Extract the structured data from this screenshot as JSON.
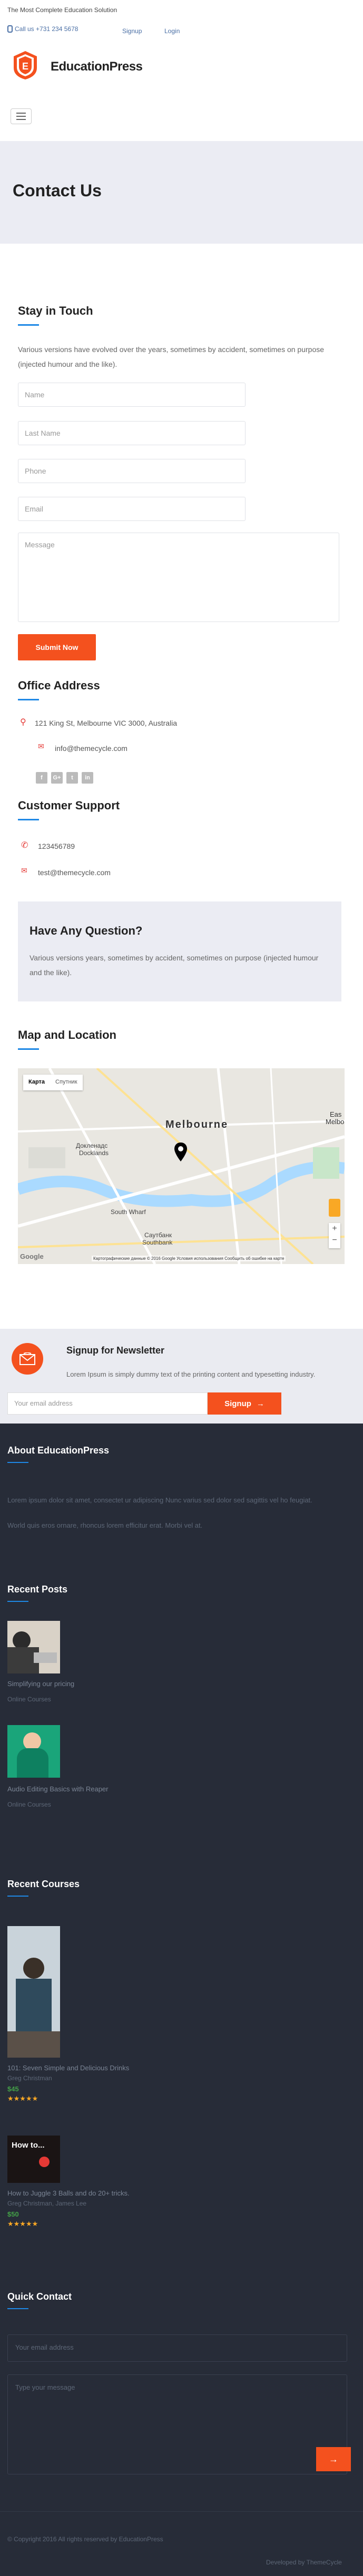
{
  "topbar": {
    "tagline": "The Most Complete Education Solution",
    "callus": "Call us +731 234 5678",
    "signup": "Signup",
    "login": "Login"
  },
  "brand": {
    "name": "EducationPress",
    "badge_letter": "E"
  },
  "hero": {
    "title": "Contact Us"
  },
  "stay": {
    "title": "Stay in Touch",
    "text": "Various versions have evolved over the years, sometimes by accident, sometimes on purpose (injected humour and the like).",
    "name_ph": "Name",
    "lastname_ph": "Last Name",
    "phone_ph": "Phone",
    "email_ph": "Email",
    "message_ph": "Message",
    "submit": "Submit Now"
  },
  "office": {
    "title": "Office Address",
    "address": "121 King St, Melbourne VIC 3000, Australia",
    "email": "info@themecycle.com",
    "social": [
      "f",
      "G+",
      "t",
      "in"
    ]
  },
  "support": {
    "title": "Customer Support",
    "phone": "123456789",
    "email": "test@themecycle.com"
  },
  "question": {
    "title": "Have Any Question?",
    "text": "Various versions years, sometimes by accident, sometimes on purpose (injected humour and the like)."
  },
  "map": {
    "title": "Map and Location",
    "tab_map": "Карта",
    "tab_satellite": "Спутник",
    "city": "Melbourne",
    "docklands": "Докленадс",
    "docklands2": "Docklands",
    "south_wharf": "South Wharf",
    "southbank_ru": "Саутбанк",
    "southbank": "Southbank",
    "east": "Eas",
    "east2": "Melbo",
    "attribution": "Картографические данные © 2016 Google   Условия использования   Сообщить об ошибке на карте",
    "google": "Google"
  },
  "newsletter": {
    "title": "Signup for Newsletter",
    "text": "Lorem Ipsum is simply dummy text of the printing content and typesetting industry.",
    "email_ph": "Your email address",
    "button": "Signup"
  },
  "footer": {
    "about_title": "About EducationPress",
    "about_text1": "Lorem ipsum dolor sit amet, consectet ur adipiscing Nunc varius sed dolor sed sagittis vel ho feugiat.",
    "about_text2": "World quis eros ornare, rhoncus lorem efficitur erat. Morbi vel at.",
    "posts_title": "Recent Posts",
    "posts": [
      {
        "title": "Simplifying our pricing",
        "category": "Online Courses"
      },
      {
        "title": "Audio Editing Basics with Reaper",
        "category": "Online Courses"
      }
    ],
    "courses_title": "Recent Courses",
    "courses": [
      {
        "title": "101: Seven Simple and Delicious Drinks",
        "author": "Greg Christman",
        "price": "$45",
        "stars": "★★★★★"
      },
      {
        "title": "How to Juggle 3 Balls and do 20+ tricks.",
        "author": "Greg Christman, James Lee",
        "price": "$50",
        "stars": "★★★★★",
        "thumb_text": "How to..."
      }
    ],
    "quick_title": "Quick Contact",
    "quick_email_ph": "Your email address",
    "quick_message_ph": "Type your message",
    "copyright": "© Copyright 2016 All rights reserved by EducationPress",
    "developed": "Developed by ThemeCycle"
  },
  "colors": {
    "accent": "#f4511e",
    "blue": "#1e88e5",
    "footer_bg": "#272c38"
  }
}
